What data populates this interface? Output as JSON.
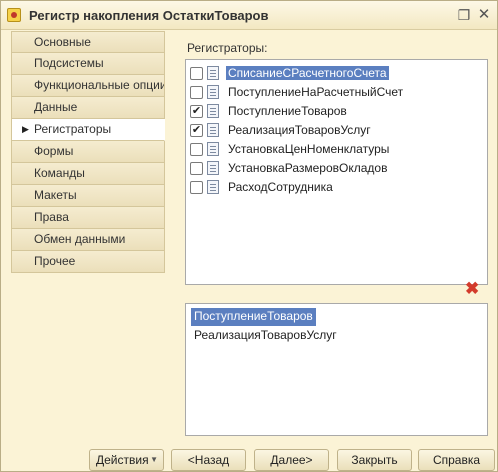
{
  "window": {
    "title": "Регистр накопления ОстаткиТоваров",
    "restore_glyph": "❐",
    "close_glyph": "✕"
  },
  "tabs": [
    {
      "label": "Основные",
      "active": false
    },
    {
      "label": "Подсистемы",
      "active": false
    },
    {
      "label": "Функциональные опции",
      "active": false
    },
    {
      "label": "Данные",
      "active": false
    },
    {
      "label": "Регистраторы",
      "active": true
    },
    {
      "label": "Формы",
      "active": false
    },
    {
      "label": "Команды",
      "active": false
    },
    {
      "label": "Макеты",
      "active": false
    },
    {
      "label": "Права",
      "active": false
    },
    {
      "label": "Обмен данными",
      "active": false
    },
    {
      "label": "Прочее",
      "active": false
    }
  ],
  "registrators": {
    "label": "Регистраторы:",
    "items": [
      {
        "label": "СписаниеСРасчетногоСчета",
        "checked": false,
        "selected": true
      },
      {
        "label": "ПоступлениеНаРасчетныйСчет",
        "checked": false,
        "selected": false
      },
      {
        "label": "ПоступлениеТоваров",
        "checked": true,
        "selected": false
      },
      {
        "label": "РеализацияТоваровУслуг",
        "checked": true,
        "selected": false
      },
      {
        "label": "УстановкаЦенНоменклатуры",
        "checked": false,
        "selected": false
      },
      {
        "label": "УстановкаРазмеровОкладов",
        "checked": false,
        "selected": false
      },
      {
        "label": "РасходСотрудника",
        "checked": false,
        "selected": false
      }
    ]
  },
  "selected_list": [
    {
      "label": "ПоступлениеТоваров",
      "selected": true
    },
    {
      "label": "РеализацияТоваровУслуг",
      "selected": false
    }
  ],
  "buttons": {
    "actions": "Действия",
    "back": "<Назад",
    "next": "Далее>",
    "close": "Закрыть",
    "help": "Справка"
  },
  "icons": {
    "delete": "delete-icon",
    "dropdown": "chevron-down-icon",
    "tab_arrow": "triangle-right-icon"
  }
}
